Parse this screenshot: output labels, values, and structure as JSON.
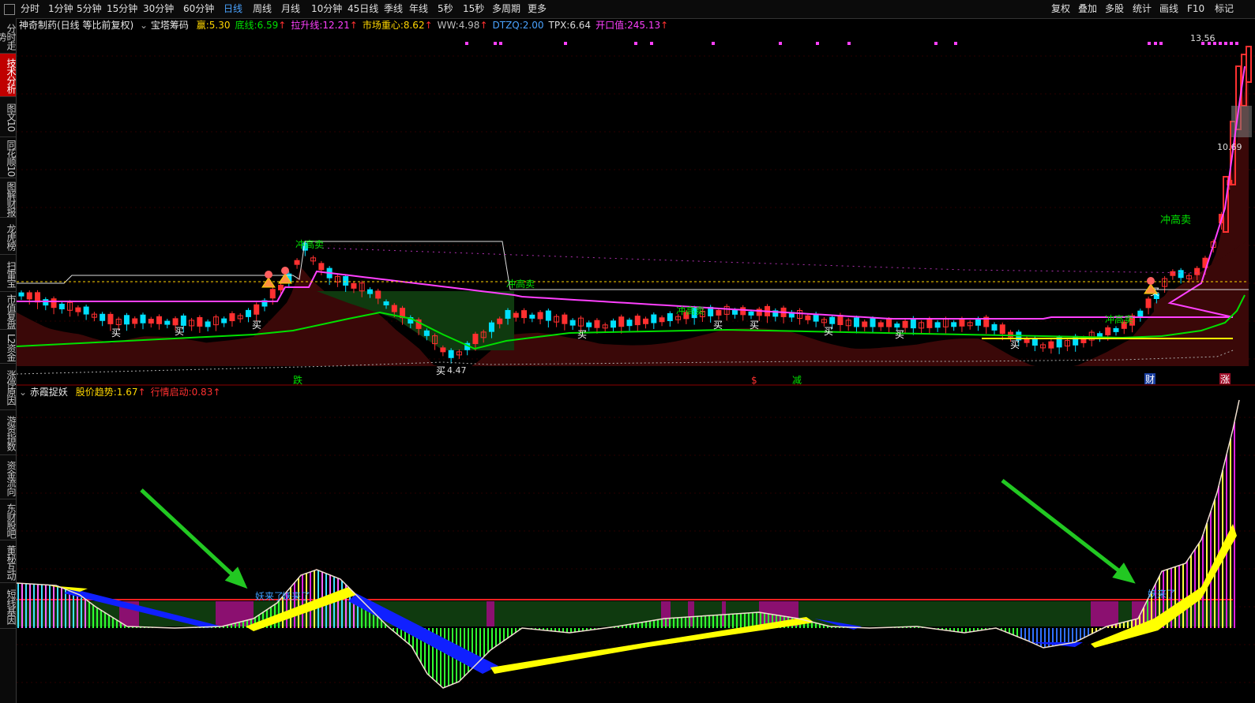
{
  "toolbar": {
    "periods": [
      "分时",
      "1分钟",
      "5分钟",
      "15分钟",
      "30分钟",
      "60分钟",
      "日线",
      "周线",
      "月线",
      "10分钟",
      "45日线",
      "季线",
      "年线",
      "5秒",
      "15秒",
      "多周期",
      "更多"
    ],
    "active_period": "日线",
    "right_buttons": [
      "复权",
      "叠加",
      "多股",
      "统计",
      "画线",
      "F10",
      "标记"
    ]
  },
  "sidebar": {
    "tabs": [
      {
        "label": "分时走势",
        "active": false
      },
      {
        "label": "技术分析",
        "active": true
      },
      {
        "label": "图文10",
        "active": false
      },
      {
        "label": "同花顺10",
        "active": false
      },
      {
        "label": "图解财报",
        "active": false
      },
      {
        "label": "龙虎榜",
        "active": false
      },
      {
        "label": "扫雷宝",
        "active": false
      },
      {
        "label": "市值复盘",
        "active": false
      },
      {
        "label": "L2资金",
        "active": false
      },
      {
        "label": "涨停原因",
        "active": false
      },
      {
        "label": "游资指数",
        "active": false
      },
      {
        "label": "资金流向",
        "active": false
      },
      {
        "label": "东财股吧",
        "active": false
      },
      {
        "label": "董秘互动",
        "active": false
      },
      {
        "label": "短线基因",
        "active": false
      }
    ]
  },
  "main_panel": {
    "stock_name": "神奇制药(日线 等比前复权)",
    "indicator_name": "宝塔筹码",
    "items": [
      {
        "label": "赢:",
        "value": "5.30",
        "color": "#ffd700",
        "arrow": ""
      },
      {
        "label": "底线:",
        "value": "6.59",
        "color": "#00e000",
        "arrow": "↑"
      },
      {
        "label": "拉升线:",
        "value": "12.21",
        "color": "#ff40ff",
        "arrow": "↑"
      },
      {
        "label": "市场重心:",
        "value": "8.62",
        "color": "#ffd700",
        "arrow": "↑"
      },
      {
        "label": "WW:",
        "value": "4.98",
        "color": "#bbbbbb",
        "arrow": "↑"
      },
      {
        "label": "DTZQ:",
        "value": "2.00",
        "color": "#4aa3ff",
        "arrow": ""
      },
      {
        "label": "TPX:",
        "value": "6.64",
        "color": "#dddddd",
        "arrow": ""
      },
      {
        "label": "开口值:",
        "value": "245.13",
        "color": "#ff40ff",
        "arrow": "↑"
      }
    ],
    "price_high": "13.56",
    "price_mid": "10.69",
    "price_low_label": "4.47",
    "chart_labels": {
      "buy": "买",
      "sell_high": "冲高卖",
      "low_buy": "买",
      "die": "跌",
      "jian": "减",
      "cai": "财",
      "zhang": "涨",
      "dollar": "$"
    }
  },
  "sub_panel": {
    "indicator_name": "赤霞捉妖",
    "items": [
      {
        "label": "股价趋势:",
        "value": "1.67",
        "color": "#ffd700",
        "arrow": "↑"
      },
      {
        "label": "行情启动:",
        "value": "0.83",
        "color": "#ff3030",
        "arrow": "↑"
      }
    ],
    "annotations": [
      "妖来了",
      "妖来了",
      "妖来了"
    ]
  },
  "colors": {
    "up": "#ff3030",
    "down": "#00e0ff",
    "flat": "#ffff00",
    "magenta": "#ff40ff",
    "green": "#00e000",
    "yellow": "#ffff00",
    "blue": "#1020ff",
    "arrow": "#22c822"
  }
}
